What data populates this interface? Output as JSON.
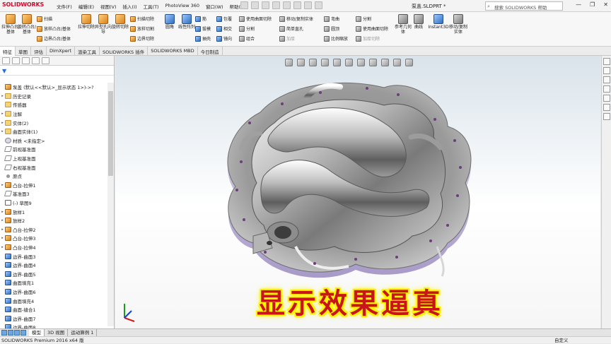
{
  "app": {
    "logo": "SOLIDWORKS",
    "doc_title": "泵盖.SLDPRT *",
    "help_placeholder": "搜索 SOLIDWORKS 帮助"
  },
  "menu": [
    "文件(F)",
    "编辑(E)",
    "视图(V)",
    "插入(I)",
    "工具(T)",
    "PhotoView 360",
    "窗口(W)",
    "帮助(H)"
  ],
  "ribbon": {
    "big": [
      "拉伸凸台/基体",
      "旋转凸台/基体",
      "拉伸切除",
      "异型孔向导",
      "旋转切除",
      "圆角",
      "线性阵列",
      "参考几何体",
      "曲线",
      "Instant3D",
      "移动/复制实体"
    ],
    "small": [
      {
        "label": "扫描",
        "icon": "sweep-icon",
        "dim": false
      },
      {
        "label": "放样凸台/基体",
        "icon": "loft-icon",
        "dim": false
      },
      {
        "label": "边界凸台/基体",
        "icon": "boundary-boss-icon",
        "dim": false
      },
      {
        "label": "扫描切除",
        "icon": "swept-cut-icon",
        "dim": false
      },
      {
        "label": "放样切割",
        "icon": "lofted-cut-icon",
        "dim": false
      },
      {
        "label": "边界切除",
        "icon": "boundary-cut-icon",
        "dim": false
      },
      {
        "label": "筋",
        "icon": "rib-icon",
        "dim": false
      },
      {
        "label": "拔模",
        "icon": "draft-icon",
        "dim": false
      },
      {
        "label": "抽壳",
        "icon": "shell-icon",
        "dim": false
      },
      {
        "label": "包覆",
        "icon": "wrap-icon",
        "dim": false
      },
      {
        "label": "相交",
        "icon": "intersect-icon",
        "dim": false
      },
      {
        "label": "镜向",
        "icon": "mirror-icon",
        "dim": false
      },
      {
        "label": "使用曲面切除",
        "icon": "surface-cut-icon",
        "dim": false
      },
      {
        "label": "分割",
        "icon": "split-icon",
        "dim": false
      },
      {
        "label": "组合",
        "icon": "combine-icon",
        "dim": false
      },
      {
        "label": "移动/复制实体",
        "icon": "move-copy-icon",
        "dim": false
      },
      {
        "label": "简单直孔",
        "icon": "simple-hole-icon",
        "dim": false
      },
      {
        "label": "加厚",
        "icon": "thicken-icon",
        "dim": true
      },
      {
        "label": "弯曲",
        "icon": "flex-icon",
        "dim": false
      },
      {
        "label": "圆顶",
        "icon": "dome-icon",
        "dim": false
      },
      {
        "label": "比例缩放",
        "icon": "scale-icon",
        "dim": false
      },
      {
        "label": "分割",
        "icon": "split-icon",
        "dim": false
      },
      {
        "label": "使用曲面切除",
        "icon": "surface-cut-icon",
        "dim": false
      },
      {
        "label": "加厚切除",
        "icon": "thicken-cut-icon",
        "dim": true
      }
    ]
  },
  "tabs": [
    "特征",
    "草图",
    "评估",
    "DimXpert",
    "渲染工具",
    "SOLIDWORKS 插件",
    "SOLIDWORKS MBD",
    "今日制造"
  ],
  "tree": [
    {
      "label": "泵盖 (默认<<默认>_显示状态 1>)->?",
      "icon": "fe",
      "ex": ""
    },
    {
      "label": "历史记录",
      "icon": "fo",
      "ex": "▸"
    },
    {
      "label": "传感器",
      "icon": "fo",
      "ex": ""
    },
    {
      "label": "注解",
      "icon": "fo",
      "ex": "▸"
    },
    {
      "label": "实体(2)",
      "icon": "fo",
      "ex": "▸"
    },
    {
      "label": "曲面实体(1)",
      "icon": "fo",
      "ex": "▸"
    },
    {
      "label": "材质 <未指定>",
      "icon": "mt",
      "ex": ""
    },
    {
      "label": "前视基准面",
      "icon": "pl",
      "ex": ""
    },
    {
      "label": "上视基准面",
      "icon": "pl",
      "ex": ""
    },
    {
      "label": "右视基准面",
      "icon": "pl",
      "ex": ""
    },
    {
      "label": "原点",
      "icon": "pt",
      "ex": ""
    },
    {
      "label": "凸台-拉伸1",
      "icon": "fe",
      "ex": "▸"
    },
    {
      "label": "基准面3",
      "icon": "pl",
      "ex": ""
    },
    {
      "label": "(-) 草图9",
      "icon": "sk",
      "ex": ""
    },
    {
      "label": "放样1",
      "icon": "fe",
      "ex": "▸"
    },
    {
      "label": "放样2",
      "icon": "fe",
      "ex": "▸"
    },
    {
      "label": "凸台-拉伸2",
      "icon": "fe",
      "ex": "▸"
    },
    {
      "label": "凸台-拉伸3",
      "icon": "fe",
      "ex": "▸"
    },
    {
      "label": "凸台-拉伸4",
      "icon": "fe",
      "ex": "▸"
    },
    {
      "label": "边界-曲面3",
      "icon": "su",
      "ex": ""
    },
    {
      "label": "边界-曲面4",
      "icon": "su",
      "ex": ""
    },
    {
      "label": "边界-曲面5",
      "icon": "su",
      "ex": ""
    },
    {
      "label": "曲面填充1",
      "icon": "su",
      "ex": ""
    },
    {
      "label": "边界-曲面6",
      "icon": "su",
      "ex": ""
    },
    {
      "label": "曲面填充4",
      "icon": "su",
      "ex": ""
    },
    {
      "label": "曲面-缝合1",
      "icon": "su",
      "ex": ""
    },
    {
      "label": "边界-曲面7",
      "icon": "su",
      "ex": ""
    },
    {
      "label": "边界-曲面8",
      "icon": "su",
      "ex": ""
    }
  ],
  "caption": "显示效果逼真",
  "bottom_tabs": [
    "模型",
    "3D 视图",
    "运动算例 1"
  ],
  "status": {
    "left": "SOLIDWORKS Premium 2016 x64 版",
    "right": "自定义"
  }
}
